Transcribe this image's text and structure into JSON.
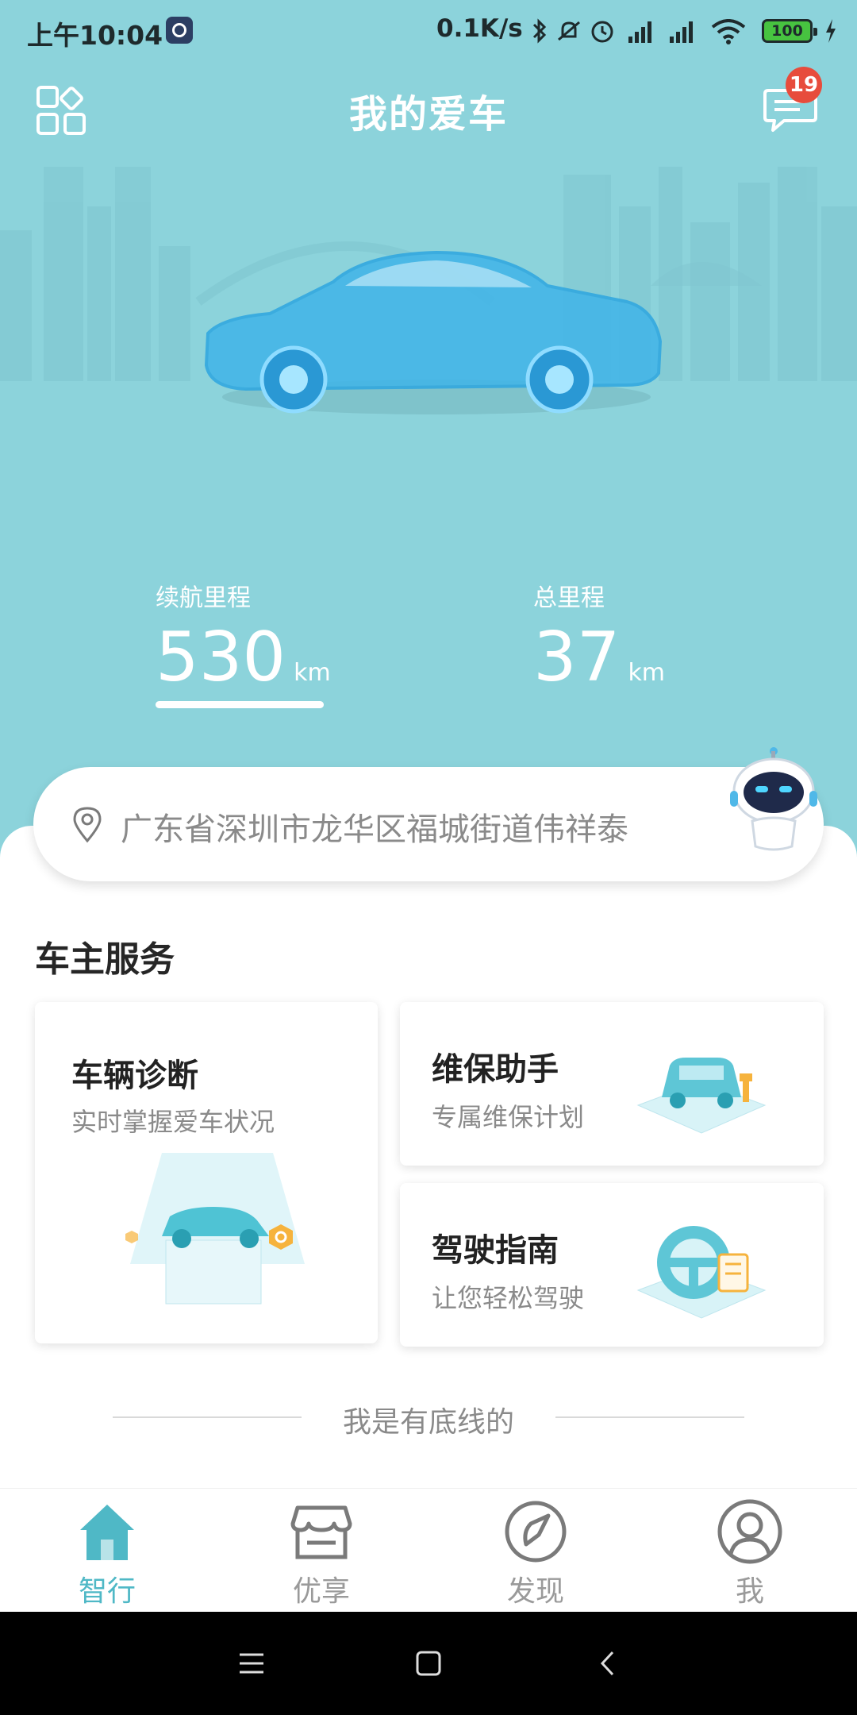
{
  "status_bar": {
    "time": "上午10:04",
    "network_speed": "0.1K/s",
    "battery": "100",
    "icons": [
      "incall-app-icon",
      "bluetooth-icon",
      "mute-icon",
      "alarm-icon",
      "signal-hd-icon",
      "signal-hd-icon",
      "wifi-icon",
      "battery-icon",
      "charging-icon"
    ]
  },
  "header": {
    "title": "我的爱车",
    "message_badge": "19",
    "left_icon": "grid-menu-icon",
    "right_icon": "message-icon"
  },
  "stats": {
    "range": {
      "label": "续航里程",
      "value": "530",
      "unit": "km"
    },
    "total": {
      "label": "总里程",
      "value": "37",
      "unit": "km"
    }
  },
  "address": {
    "text": "广东省深圳市龙华区福城街道伟祥泰"
  },
  "services": {
    "title": "车主服务",
    "diagnosis": {
      "title": "车辆诊断",
      "subtitle": "实时掌握爱车状况"
    },
    "maintenance": {
      "title": "维保助手",
      "subtitle": "专属维保计划"
    },
    "driving": {
      "title": "驾驶指南",
      "subtitle": "让您轻松驾驶"
    }
  },
  "footer_text": "我是有底线的",
  "tabs": [
    {
      "label": "智行",
      "icon": "home-icon",
      "active": true
    },
    {
      "label": "优享",
      "icon": "store-icon",
      "active": false
    },
    {
      "label": "发现",
      "icon": "compass-icon",
      "active": false
    },
    {
      "label": "我",
      "icon": "profile-icon",
      "active": false
    }
  ],
  "colors": {
    "accent": "#4fb8c6",
    "hero_bg": "#8cd3db",
    "badge": "#e74c3c"
  }
}
